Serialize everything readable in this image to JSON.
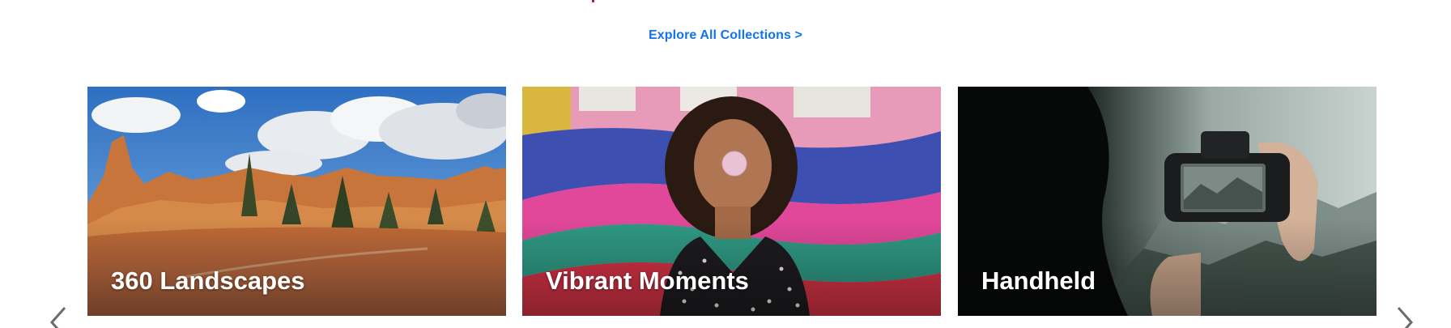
{
  "header": {
    "explore_label": "Explore All Collections >"
  },
  "collections": [
    {
      "title": "360 Landscapes",
      "scene": "red-rock canyon panorama under cloudy blue sky"
    },
    {
      "title": "Vibrant Moments",
      "scene": "woman blowing bubble gum in front of colorful striped wall"
    },
    {
      "title": "Handheld",
      "scene": "hands holding a DSLR camera over misty forest valley"
    }
  ],
  "carousel": {
    "prev_icon": "chevron-left-icon",
    "next_icon": "chevron-right-icon"
  },
  "colors": {
    "link": "#1473e6",
    "accent_mark": "#c0102a",
    "card_text": "#ffffff"
  }
}
